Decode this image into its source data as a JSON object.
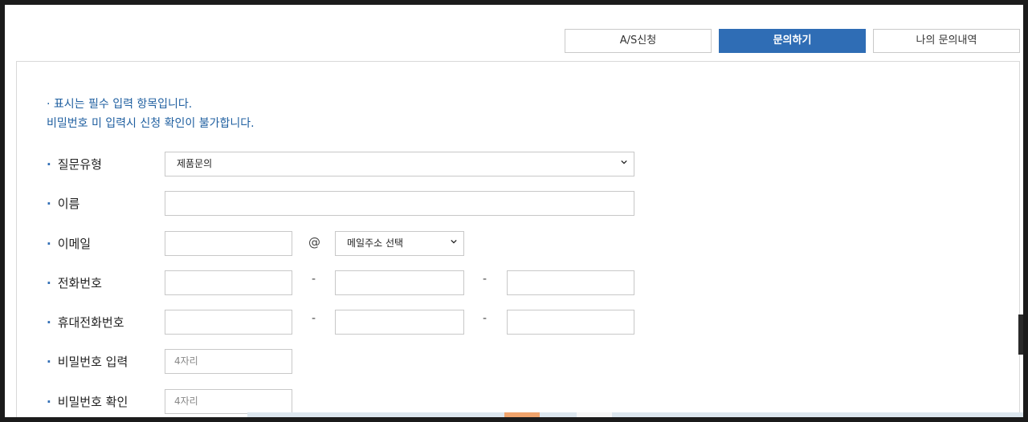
{
  "tabs": [
    {
      "label": "A/S신청",
      "active": false
    },
    {
      "label": "문의하기",
      "active": true
    },
    {
      "label": "나의 문의내역",
      "active": false
    }
  ],
  "notice": {
    "line1": "· 표시는 필수 입력 항목입니다.",
    "line2": "비밀번호 미 입력시 신청 확인이 불가합니다."
  },
  "bullet": "·",
  "form": {
    "question_type": {
      "label": "질문유형",
      "value": "제품문의"
    },
    "name": {
      "label": "이름",
      "value": ""
    },
    "email": {
      "label": "이메일",
      "local_value": "",
      "at": "@",
      "domain_value": "메일주소 선택"
    },
    "phone": {
      "label": "전화번호",
      "sep": "-",
      "part1": "",
      "part2": "",
      "part3": ""
    },
    "mobile": {
      "label": "휴대전화번호",
      "sep": "-",
      "part1": "",
      "part2": "",
      "part3": ""
    },
    "password": {
      "label": "비밀번호 입력",
      "placeholder": "4자리"
    },
    "password_confirm": {
      "label": "비밀번호 확인",
      "placeholder": "4자리"
    }
  },
  "colors": {
    "accent": "#2f6db5",
    "notice_text": "#1f5fa0",
    "border": "#c8c8c8"
  }
}
